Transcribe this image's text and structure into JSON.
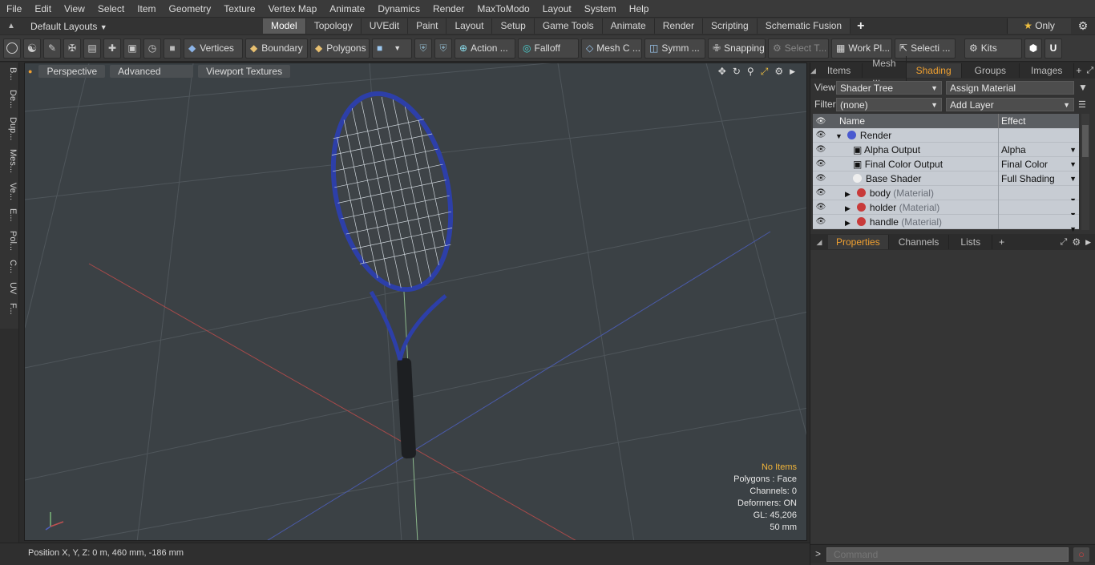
{
  "menu": [
    "File",
    "Edit",
    "View",
    "Select",
    "Item",
    "Geometry",
    "Texture",
    "Vertex Map",
    "Animate",
    "Dynamics",
    "Render",
    "MaxToModo",
    "Layout",
    "System",
    "Help"
  ],
  "layout_row": {
    "layout_select": "Default Layouts",
    "tabs": [
      "Model",
      "Topology",
      "UVEdit",
      "Paint",
      "Layout",
      "Setup",
      "Game Tools",
      "Animate",
      "Render",
      "Scripting",
      "Schematic Fusion"
    ],
    "active_tab": "Model",
    "add_label": "+",
    "only_label": "Only"
  },
  "toolbar": {
    "vertices": "Vertices",
    "boundary": "Boundary",
    "polygons": "Polygons",
    "action": "Action ...",
    "falloff": "Falloff",
    "mesh": "Mesh C ...",
    "symm": "Symm ...",
    "snapping": "Snapping",
    "select_t": "Select T...",
    "work_pl": "Work Pl...",
    "selecti": "Selecti ...",
    "kits": "Kits"
  },
  "left_tabs": [
    "B...",
    "De...",
    "Dup...",
    "Mes...",
    "Ve...",
    "E...",
    "Pol...",
    "C...",
    "UV",
    "F..."
  ],
  "viewport": {
    "buttons": [
      "Perspective",
      "Advanced",
      "Viewport Textures"
    ],
    "info": {
      "status": "No Items",
      "polygons": "Polygons : Face",
      "channels": "Channels: 0",
      "deformers": "Deformers: ON",
      "gl": "GL: 45,206",
      "scale": "50 mm"
    }
  },
  "status": {
    "position": "Position X, Y, Z:   0 m, 460 mm, -186 mm"
  },
  "right": {
    "top_tabs": [
      "Items",
      "Mesh ...",
      "Shading",
      "Groups",
      "Images"
    ],
    "active_top_tab": "Shading",
    "view_label": "View",
    "view_value": "Shader Tree",
    "assign_material": "Assign Material",
    "filter_label": "Filter",
    "filter_value": "(none)",
    "add_layer": "Add Layer",
    "col_name": "Name",
    "col_effect": "Effect",
    "tree": [
      {
        "name": "Render",
        "sub": "",
        "effect": "",
        "kind": "render"
      },
      {
        "name": "Alpha Output",
        "sub": "",
        "effect": "Alpha",
        "kind": "output"
      },
      {
        "name": "Final Color Output",
        "sub": "",
        "effect": "Final Color",
        "kind": "output"
      },
      {
        "name": "Base Shader",
        "sub": "",
        "effect": "Full Shading",
        "kind": "shader"
      },
      {
        "name": "body",
        "sub": "(Material)",
        "effect": "",
        "kind": "material"
      },
      {
        "name": "holder",
        "sub": "(Material)",
        "effect": "",
        "kind": "material"
      },
      {
        "name": "handle",
        "sub": "(Material)",
        "effect": "",
        "kind": "material"
      }
    ],
    "bottom_tabs": [
      "Properties",
      "Channels",
      "Lists"
    ],
    "active_bottom_tab": "Properties",
    "command_placeholder": "Command"
  },
  "colors": {
    "accent": "#f0a030",
    "racket_frame": "#2d3fa8",
    "viewport_bg": "#3b4145"
  }
}
